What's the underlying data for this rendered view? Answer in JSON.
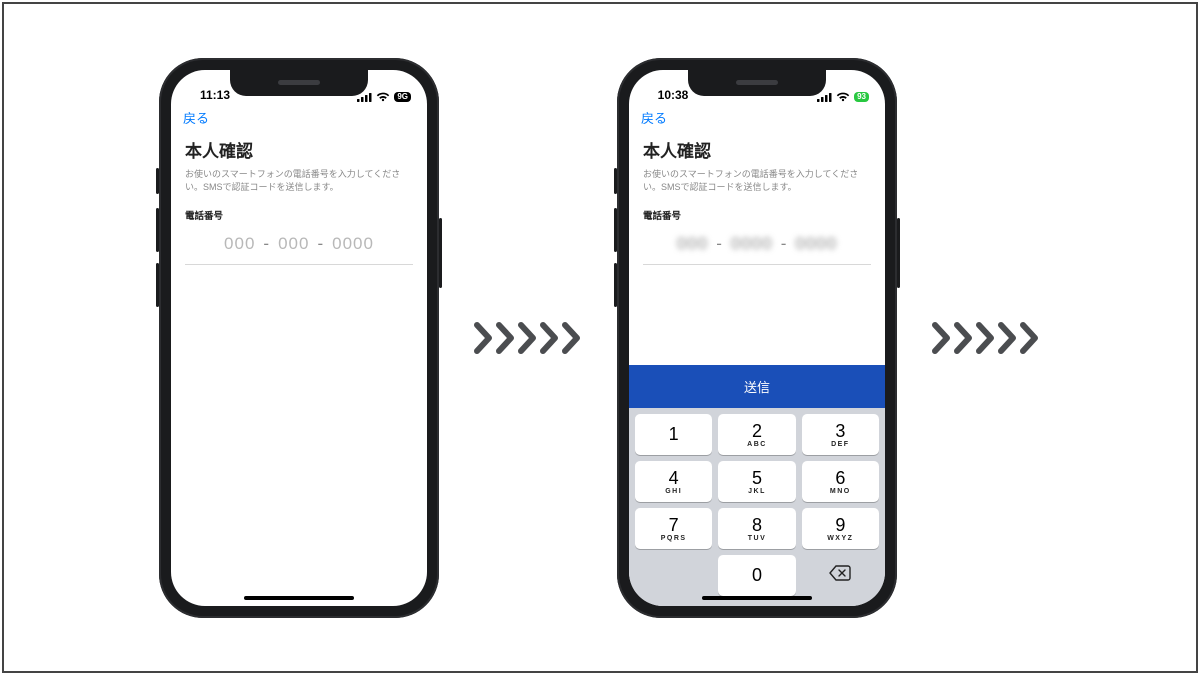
{
  "phone1": {
    "status": {
      "time": "11:13",
      "battery_label": "9G"
    },
    "nav_back": "戻る",
    "heading": "本人確認",
    "subtext": "お使いのスマートフォンの電話番号を入力してください。SMSで認証コードを送信します。",
    "field_label": "電話番号",
    "input": {
      "seg1": "000",
      "sep": "-",
      "seg2": "000",
      "seg3": "0000"
    }
  },
  "phone2": {
    "status": {
      "time": "10:38",
      "battery_label": "93"
    },
    "nav_back": "戻る",
    "heading": "本人確認",
    "subtext": "お使いのスマートフォンの電話番号を入力してください。SMSで認証コードを送信します。",
    "field_label": "電話番号",
    "input": {
      "seg1": "000",
      "sep": "-",
      "seg2": "0000",
      "seg3": "0000"
    },
    "submit_label": "送信",
    "keypad": [
      {
        "n": "1",
        "sub": ""
      },
      {
        "n": "2",
        "sub": "ABC"
      },
      {
        "n": "3",
        "sub": "DEF"
      },
      {
        "n": "4",
        "sub": "GHI"
      },
      {
        "n": "5",
        "sub": "JKL"
      },
      {
        "n": "6",
        "sub": "MNO"
      },
      {
        "n": "7",
        "sub": "PQRS"
      },
      {
        "n": "8",
        "sub": "TUV"
      },
      {
        "n": "9",
        "sub": "WXYZ"
      },
      {
        "n": "0",
        "sub": ""
      }
    ]
  }
}
